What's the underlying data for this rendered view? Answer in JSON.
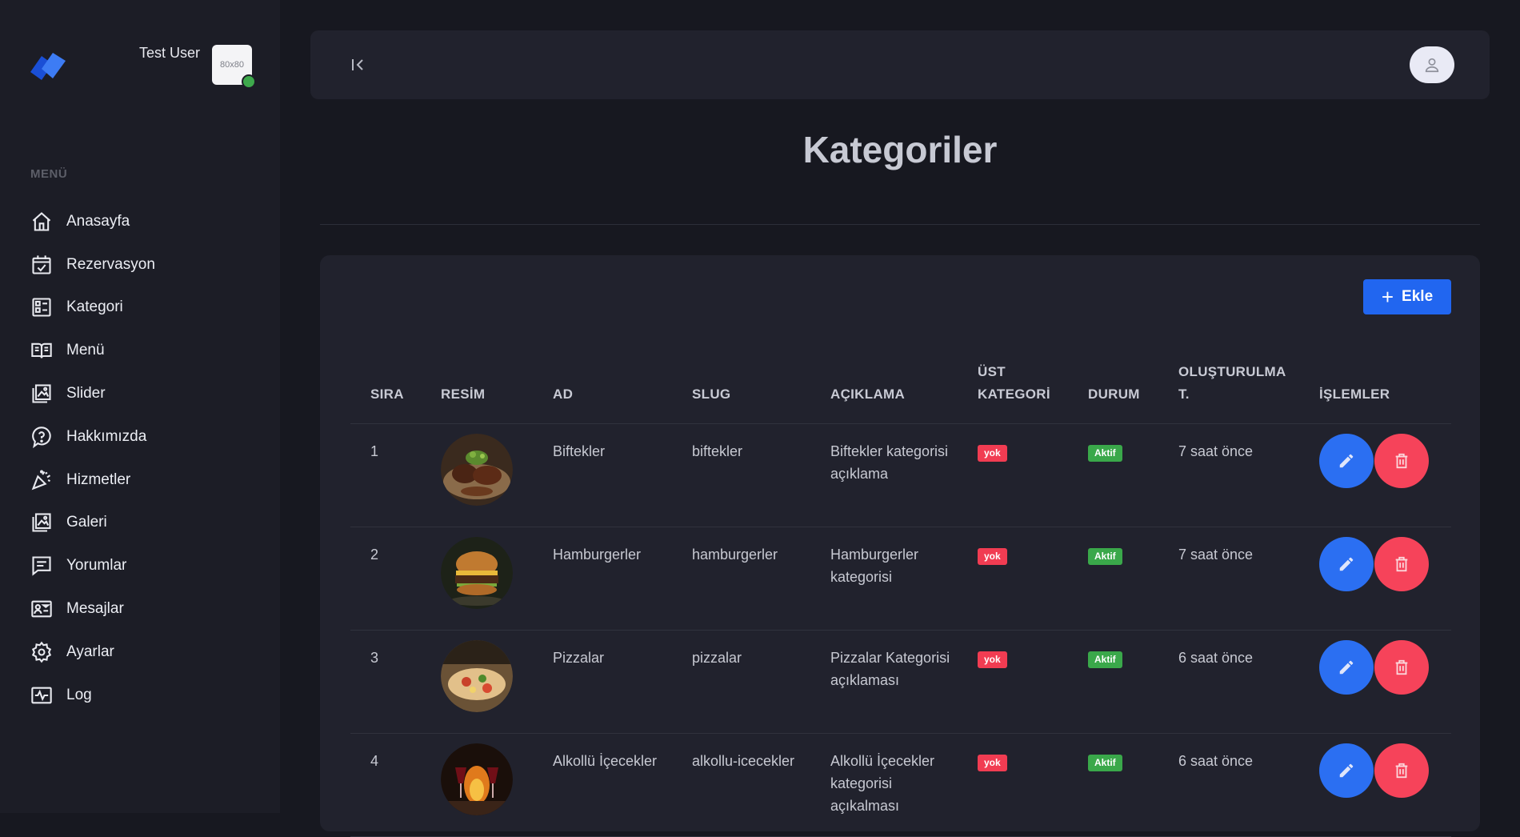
{
  "user": {
    "name": "Test User",
    "avatar_placeholder": "80x80"
  },
  "sidebar": {
    "menu_title": "MENÜ",
    "items": [
      {
        "label": "Anasayfa",
        "icon": "home-icon"
      },
      {
        "label": "Rezervasyon",
        "icon": "calendar-icon"
      },
      {
        "label": "Kategori",
        "icon": "category-list-icon"
      },
      {
        "label": "Menü",
        "icon": "book-icon"
      },
      {
        "label": "Slider",
        "icon": "images-icon"
      },
      {
        "label": "Hakkımızda",
        "icon": "question-bubble-icon"
      },
      {
        "label": "Hizmetler",
        "icon": "party-popper-icon"
      },
      {
        "label": "Galeri",
        "icon": "gallery-icon"
      },
      {
        "label": "Yorumlar",
        "icon": "comment-icon"
      },
      {
        "label": "Mesajlar",
        "icon": "contact-card-icon"
      },
      {
        "label": "Ayarlar",
        "icon": "gear-icon"
      },
      {
        "label": "Log",
        "icon": "activity-log-icon"
      }
    ]
  },
  "page": {
    "title": "Kategoriler",
    "add_label": "Ekle"
  },
  "table": {
    "headers": [
      "SIRA",
      "RESİM",
      "AD",
      "SLUG",
      "AÇIKLAMA",
      "ÜST KATEGORİ",
      "DURUM",
      "OLUŞTURULMA T.",
      "İŞLEMLER"
    ],
    "rows": [
      {
        "sira": "1",
        "image": "steak-photo",
        "ad": "Biftekler",
        "slug": "biftekler",
        "aciklama": "Biftekler kategorisi açıklama",
        "ust": "yok",
        "durum": "Aktif",
        "created": "7 saat önce"
      },
      {
        "sira": "2",
        "image": "burger-photo",
        "ad": "Hamburgerler",
        "slug": "hamburgerler",
        "aciklama": "Hamburgerler kategorisi",
        "ust": "yok",
        "durum": "Aktif",
        "created": "7 saat önce"
      },
      {
        "sira": "3",
        "image": "pizza-photo",
        "ad": "Pizzalar",
        "slug": "pizzalar",
        "aciklama": "Pizzalar Kategorisi açıklaması",
        "ust": "yok",
        "durum": "Aktif",
        "created": "6 saat önce"
      },
      {
        "sira": "4",
        "image": "wine-fire-photo",
        "ad": "Alkollü İçecekler",
        "slug": "alkollu-icecekler",
        "aciklama": "Alkollü İçecekler kategorisi açıkalması",
        "ust": "yok",
        "durum": "Aktif",
        "created": "6 saat önce"
      }
    ]
  },
  "colors": {
    "accent": "#2166f0",
    "danger": "#f6435a",
    "success": "#3aa84a",
    "background": "#171820",
    "panel": "#21222d"
  }
}
